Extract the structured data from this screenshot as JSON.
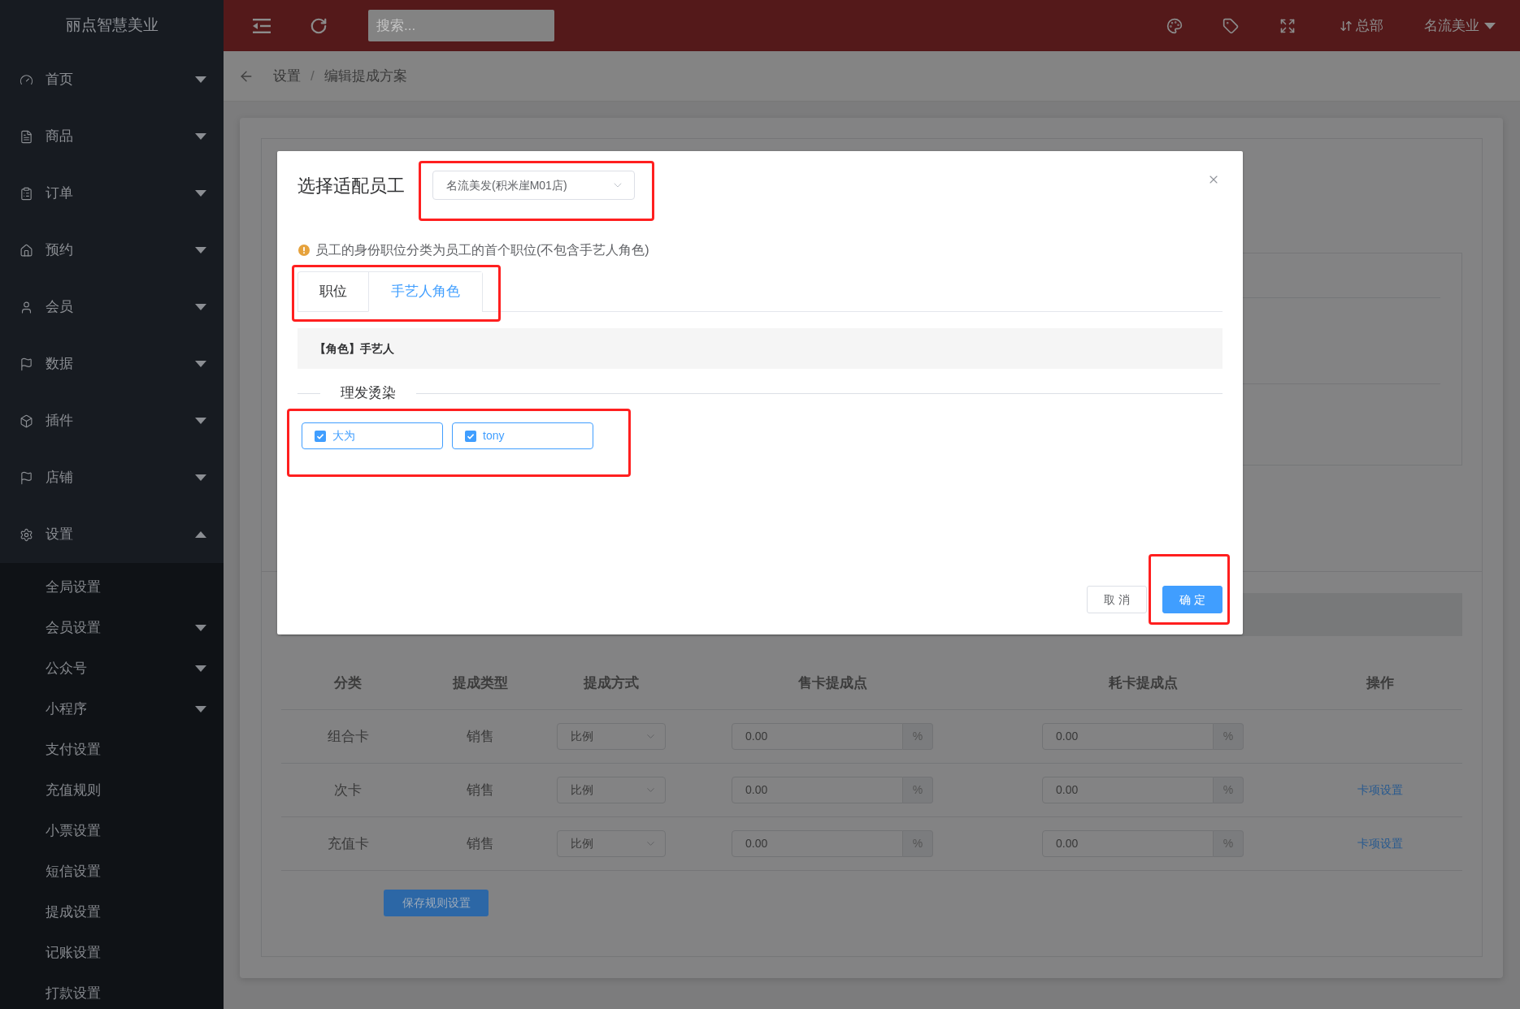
{
  "sidebar": {
    "logo": "丽点智慧美业",
    "items": [
      {
        "label": "首页",
        "expanded": false
      },
      {
        "label": "商品",
        "expanded": false
      },
      {
        "label": "订单",
        "expanded": false
      },
      {
        "label": "预约",
        "expanded": false
      },
      {
        "label": "会员",
        "expanded": false
      },
      {
        "label": "数据",
        "expanded": false
      },
      {
        "label": "插件",
        "expanded": false
      },
      {
        "label": "店铺",
        "expanded": false
      },
      {
        "label": "设置",
        "expanded": true,
        "children": [
          {
            "label": "全局设置",
            "kind": "link"
          },
          {
            "label": "会员设置",
            "kind": "group",
            "expanded": false
          },
          {
            "label": "公众号",
            "kind": "group",
            "expanded": false
          },
          {
            "label": "小程序",
            "kind": "group",
            "expanded": false
          },
          {
            "label": "支付设置",
            "kind": "link"
          },
          {
            "label": "充值规则",
            "kind": "link"
          },
          {
            "label": "小票设置",
            "kind": "link"
          },
          {
            "label": "短信设置",
            "kind": "link"
          },
          {
            "label": "提成设置",
            "kind": "link"
          },
          {
            "label": "记账设置",
            "kind": "link"
          },
          {
            "label": "打款设置",
            "kind": "link"
          }
        ]
      }
    ]
  },
  "top_bar": {
    "search": {
      "placeholder": "搜索..."
    },
    "branch": "总部",
    "user": "名流美业"
  },
  "breadcrumb": {
    "items": [
      "设置",
      "编辑提成方案"
    ],
    "separator": "/"
  },
  "commission_table": {
    "columns": [
      "分类",
      "提成类型",
      "提成方式",
      "售卡提成点",
      "耗卡提成点",
      "操作"
    ],
    "rows": [
      {
        "category": "组合卡",
        "type": "销售",
        "method": "比例",
        "sale_rate": "0.00",
        "sale_unit": "%",
        "use_rate": "0.00",
        "use_unit": "%"
      },
      {
        "category": "次卡",
        "type": "销售",
        "method": "比例",
        "sale_rate": "0.00",
        "sale_unit": "%",
        "use_rate": "0.00",
        "use_unit": "%",
        "action": "卡项设置"
      },
      {
        "category": "充值卡",
        "type": "销售",
        "method": "比例",
        "sale_rate": "0.00",
        "sale_unit": "%",
        "use_rate": "0.00",
        "use_unit": "%",
        "action": "卡项设置"
      }
    ],
    "save_button": "保存规则设置"
  },
  "modal": {
    "title": "选择适配员工",
    "store_select": {
      "value": "名流美发(积米崖M01店)",
      "highlighted": true
    },
    "notice": "员工的身份职位分类为员工的首个职位(不包含手艺人角色)",
    "tab_bar": {
      "highlighted": true,
      "tabs": [
        {
          "label": "职位",
          "selected": false
        },
        {
          "label": "手艺人角色",
          "selected": true
        }
      ]
    },
    "role_header": "【角色】手艺人",
    "group_title": "理发烫染",
    "staff": {
      "highlighted": true,
      "items": [
        {
          "name": "大为",
          "checked": true
        },
        {
          "name": "tony",
          "checked": true
        }
      ]
    },
    "buttons": [
      {
        "label": "取 消",
        "kind": "default",
        "highlighted": false
      },
      {
        "label": "确 定",
        "kind": "primary",
        "highlighted": true
      }
    ]
  }
}
